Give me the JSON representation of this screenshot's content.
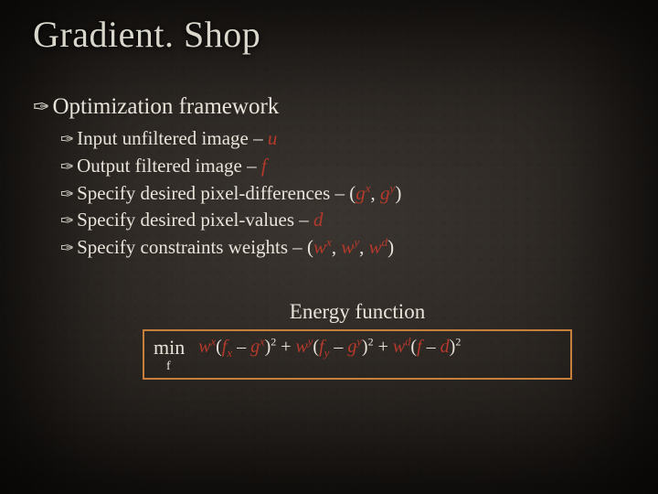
{
  "title": "Gradient. Shop",
  "bullets": {
    "lvl1": "Optimization framework",
    "items": [
      {
        "pre": "Input unfiltered image – ",
        "sym": "u",
        "post": ""
      },
      {
        "pre": "Output filtered image – ",
        "sym": "f",
        "post": ""
      },
      {
        "pre": "Specify desired pixel-differences – (",
        "sym1": "g",
        "sup1": "x",
        "mid": ", ",
        "sym2": "g",
        "sup2": "y",
        "post": ")"
      },
      {
        "pre": "Specify desired pixel-values – ",
        "sym": "d",
        "post": ""
      },
      {
        "pre": "Specify constraints weights – (",
        "sym1": "w",
        "sup1": "x",
        "mid": ", ",
        "sym2": "w",
        "sup2": "y",
        "mid2": ", ",
        "sym3": "w",
        "sup3": "d",
        "post": ")"
      }
    ]
  },
  "formula": {
    "label": "Energy function",
    "min": "min",
    "minsub": "f",
    "t1_w": "w",
    "t1_ws": "x",
    "t1_f": "f",
    "t1_fs": "x",
    "t1_g": "g",
    "t1_gs": "x",
    "t2_w": "w",
    "t2_ws": "y",
    "t2_f": "f",
    "t2_fs": "y",
    "t2_g": "g",
    "t2_gs": "y",
    "t3_w": "w",
    "t3_ws": "d",
    "t3_f": "f",
    "t3_d": "d",
    "plus": " + ",
    "minus": " – ",
    "lp": "(",
    "rp": ")",
    "sq": "2"
  },
  "glyph": "✑"
}
